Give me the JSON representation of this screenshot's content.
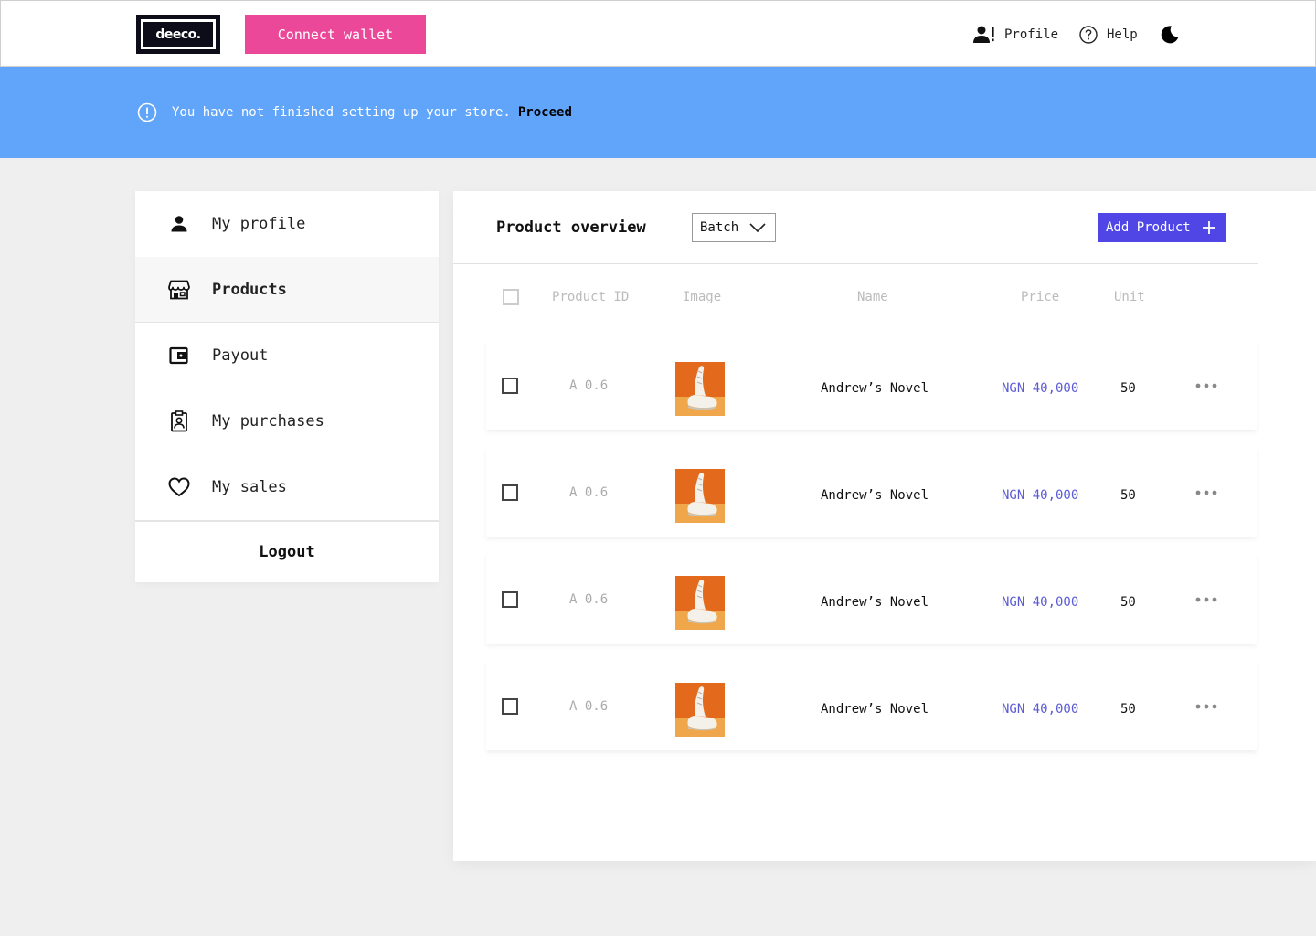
{
  "header": {
    "logo_text": "deeco.",
    "connect_wallet_label": "Connect wallet",
    "profile_label": "Profile",
    "help_label": "Help"
  },
  "banner": {
    "message": "You have not finished setting up your store.",
    "action_label": "Proceed",
    "color": "#60a5fa"
  },
  "sidebar": {
    "items": [
      {
        "label": "My profile",
        "icon": "person-icon"
      },
      {
        "label": "Products",
        "icon": "store-icon",
        "active": true
      },
      {
        "label": "Payout",
        "icon": "wallet-icon"
      },
      {
        "label": "My purchases",
        "icon": "badge-icon"
      },
      {
        "label": "My sales",
        "icon": "heart-icon"
      }
    ],
    "logout_label": "Logout"
  },
  "main": {
    "title": "Product overview",
    "batch_select": "Batch",
    "add_product_label": "Add Product",
    "columns": [
      "Product ID",
      "Image",
      "Name",
      "Price",
      "Unit"
    ],
    "rows": [
      {
        "id": "A 0.6",
        "image": "sneaker-on-orange-photo",
        "name": "Andrew’s Novel",
        "price": "NGN 40,000",
        "unit": "50"
      },
      {
        "id": "A 0.6",
        "image": "sneaker-on-orange-photo",
        "name": "Andrew’s Novel",
        "price": "NGN 40,000",
        "unit": "50"
      },
      {
        "id": "A 0.6",
        "image": "sneaker-on-orange-photo",
        "name": "Andrew’s Novel",
        "price": "NGN 40,000",
        "unit": "50"
      },
      {
        "id": "A 0.6",
        "image": "sneaker-on-orange-photo",
        "name": "Andrew’s Novel",
        "price": "NGN 40,000",
        "unit": "50"
      }
    ]
  },
  "colors": {
    "connect_wallet": "#ec4899",
    "add_product": "#4f46e5",
    "price_text": "#5b5bd6"
  }
}
